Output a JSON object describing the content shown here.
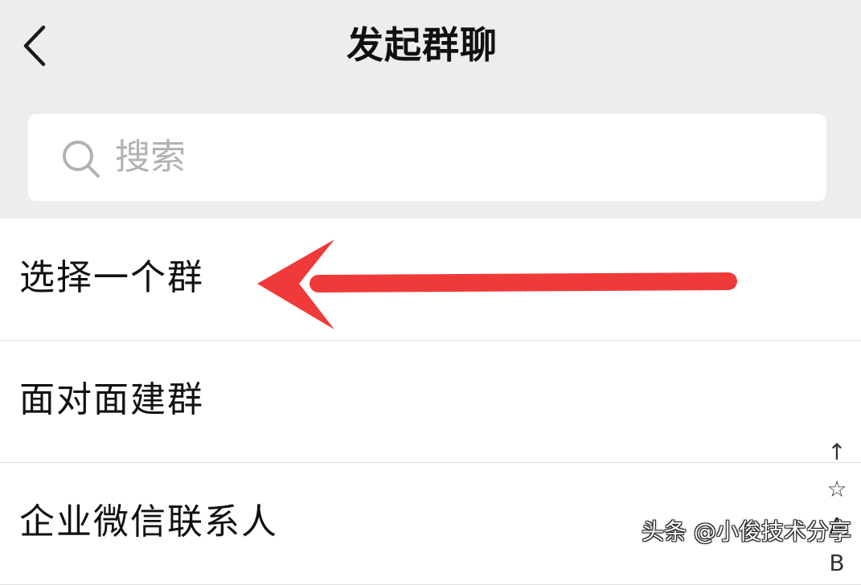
{
  "header": {
    "title": "发起群聊",
    "back_icon": "chevron-left-icon"
  },
  "search": {
    "placeholder": "搜索",
    "icon": "search-icon"
  },
  "menu": {
    "items": [
      {
        "label": "选择一个群"
      },
      {
        "label": "面对面建群"
      },
      {
        "label": "企业微信联系人"
      }
    ]
  },
  "annotation": {
    "arrow_color": "#f03a3a",
    "points_to": "选择一个群"
  },
  "index_bar": {
    "items": [
      "↑",
      "☆",
      "A",
      "B"
    ]
  },
  "watermark": {
    "text": "头条 @小俊技术分享"
  },
  "colors": {
    "header_bg": "#ededed",
    "page_bg": "#ffffff",
    "divider": "#e2e2e2",
    "placeholder": "#b2b2b2"
  }
}
